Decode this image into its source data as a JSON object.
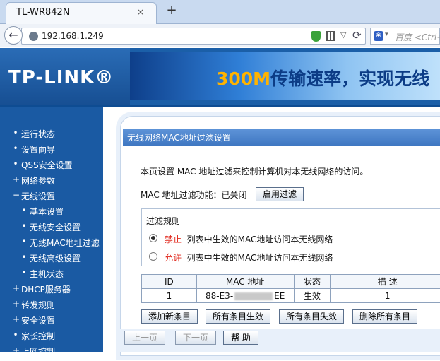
{
  "browser": {
    "tab_title": "TL-WR842N",
    "tab_close": "×",
    "new_tab": "+",
    "url": "192.168.1.249",
    "search_placeholder": "百度 <Ctrl+K>"
  },
  "banner": {
    "logo": "TP-LINK®",
    "slogan_accent": "300M",
    "slogan_rest": "传输速率，实现无线"
  },
  "sidebar": {
    "items": [
      {
        "label": "运行状态",
        "bullet": "•",
        "level": 0
      },
      {
        "label": "设置向导",
        "bullet": "•",
        "level": 0
      },
      {
        "label": "QSS安全设置",
        "bullet": "•",
        "level": 0
      },
      {
        "label": "网络参数",
        "bullet": "+",
        "level": 0
      },
      {
        "label": "无线设置",
        "bullet": "−",
        "level": 0
      },
      {
        "label": "基本设置",
        "bullet": "•",
        "level": 1
      },
      {
        "label": "无线安全设置",
        "bullet": "•",
        "level": 1
      },
      {
        "label": "无线MAC地址过滤",
        "bullet": "•",
        "level": 1
      },
      {
        "label": "无线高级设置",
        "bullet": "•",
        "level": 1
      },
      {
        "label": "主机状态",
        "bullet": "•",
        "level": 1
      },
      {
        "label": "DHCP服务器",
        "bullet": "+",
        "level": 0
      },
      {
        "label": "转发规则",
        "bullet": "+",
        "level": 0
      },
      {
        "label": "安全设置",
        "bullet": "+",
        "level": 0
      },
      {
        "label": "家长控制",
        "bullet": "•",
        "level": 0
      },
      {
        "label": "上网控制",
        "bullet": "+",
        "level": 0
      }
    ]
  },
  "panel": {
    "title": "无线网络MAC地址过滤设置",
    "description": "本页设置 MAC 地址过滤来控制计算机对本无线网络的访问。",
    "filter_status": "MAC 地址过滤功能：已关闭",
    "enable_button": "启用过滤",
    "rules_legend": "过滤规则",
    "rule_deny_keyword": "禁止",
    "rule_deny_text": "列表中生效的MAC地址访问本无线网络",
    "rule_allow_keyword": "允许",
    "rule_allow_text": "列表中生效的MAC地址访问本无线网络"
  },
  "table": {
    "headers": [
      "ID",
      "MAC 地址",
      "状态",
      "描 述"
    ],
    "rows": [
      {
        "id": "1",
        "mac_prefix": "88-E3-",
        "mac_suffix": "EE",
        "status": "生效",
        "desc": "1"
      }
    ]
  },
  "actions": {
    "add": "添加新条目",
    "all_enable": "所有条目生效",
    "all_disable": "所有条目失效",
    "delete_all": "删除所有条目"
  },
  "pager": {
    "prev": "上一页",
    "next": "下一页",
    "help": "帮 助"
  }
}
